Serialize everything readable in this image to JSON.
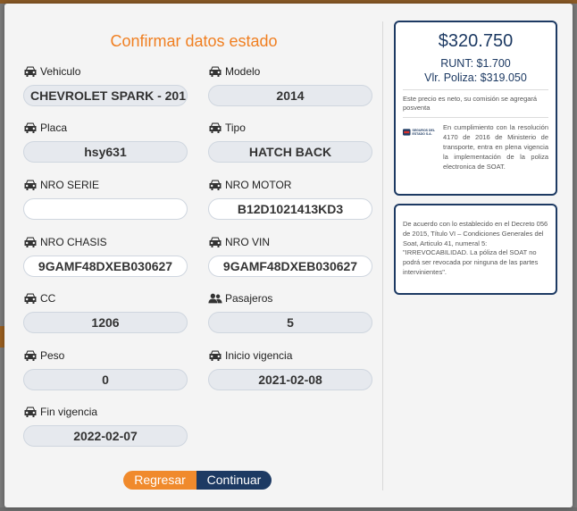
{
  "modal": {
    "title": "Confirmar datos estado",
    "fields": [
      {
        "label": "Vehiculo",
        "value": "CHEVROLET SPARK - 201",
        "icon": "car-icon"
      },
      {
        "label": "Modelo",
        "value": "2014",
        "icon": "car-icon"
      },
      {
        "label": "Placa",
        "value": "hsy631",
        "icon": "car-icon"
      },
      {
        "label": "Tipo",
        "value": "HATCH BACK",
        "icon": "car-icon"
      },
      {
        "label": "NRO SERIE",
        "value": "",
        "icon": "car-icon"
      },
      {
        "label": "NRO MOTOR",
        "value": "B12D1021413KD3",
        "icon": "car-icon"
      },
      {
        "label": "NRO CHASIS",
        "value": "9GAMF48DXEB030627",
        "icon": "car-icon"
      },
      {
        "label": "NRO VIN",
        "value": "9GAMF48DXEB030627",
        "icon": "car-icon"
      },
      {
        "label": "CC",
        "value": "1206",
        "icon": "car-icon"
      },
      {
        "label": "Pasajeros",
        "value": "5",
        "icon": "people-icon"
      },
      {
        "label": "Peso",
        "value": "0",
        "icon": "car-icon"
      },
      {
        "label": "Inicio vigencia",
        "value": "2021-02-08",
        "icon": "car-icon"
      },
      {
        "label": "Fin vigencia",
        "value": "2022-02-07",
        "icon": "car-icon"
      }
    ],
    "buttons": {
      "back": "Regresar",
      "next": "Continuar"
    }
  },
  "summary": {
    "total": "$320.750",
    "runt": "RUNT: $1.700",
    "poliza": "Vlr. Poliza: $319.050",
    "net_note": "Este precio es neto, su comisión se agregará posventa",
    "logo_text": "SEGUROS DEL ESTADO S.A.",
    "regulation": "En cumplimiento con la resolución 4170 de 2016 de Ministerio de transporte, entra en plena vigencia la implementación de la poliza electronica de SOAT.",
    "legal": "De acuerdo con lo establecido en el Decreto 056 de 2015, Título VI – Condiciones Generales del Soat, Articulo 41, numeral 5: \"IRREVOCABILIDAD. La póliza del SOAT no podrá ser revocada por ninguna de las partes intervinientes\"."
  },
  "colors": {
    "accent_orange": "#f07f21",
    "navy": "#1d3a63",
    "field_bg": "#e6e9ee"
  }
}
